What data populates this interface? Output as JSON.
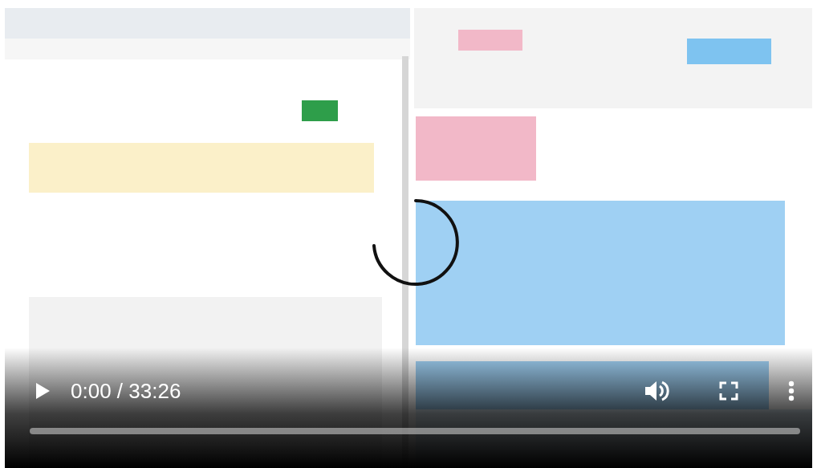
{
  "loading": true,
  "controls": {
    "playing": false,
    "time": "0:00 / 33:26",
    "progress": {
      "level": 0
    }
  }
}
